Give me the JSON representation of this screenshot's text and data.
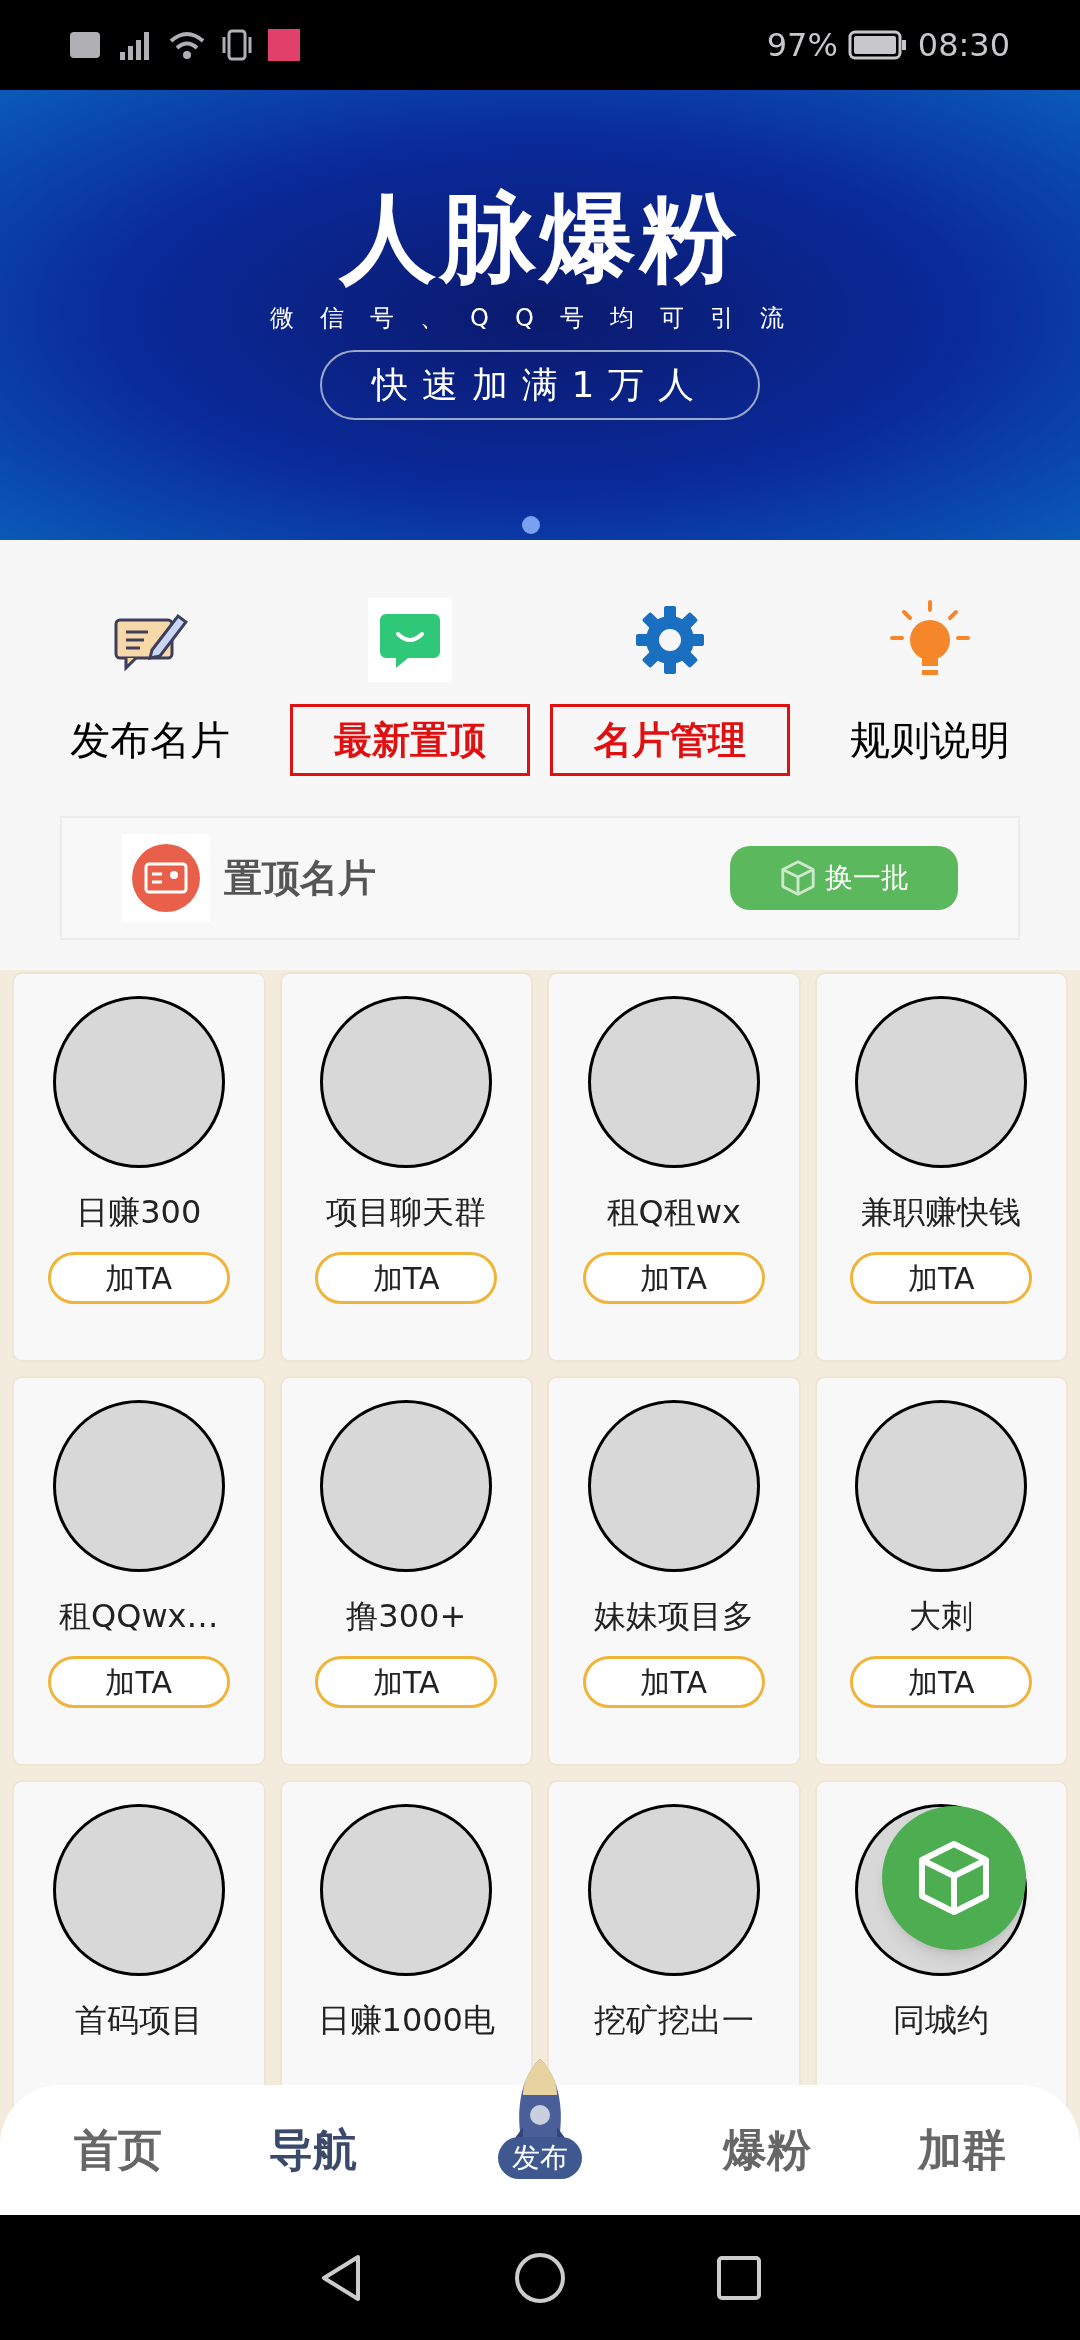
{
  "status_bar": {
    "battery": "97%",
    "time": "08:30"
  },
  "banner": {
    "title": "人脉爆粉",
    "subtitle": "微信号、QQ号均可引流",
    "pill": "快速加满1万人"
  },
  "quick_actions": [
    {
      "kind": "plain",
      "label": "发布名片"
    },
    {
      "kind": "boxed",
      "label": "最新置顶"
    },
    {
      "kind": "boxed",
      "label": "名片管理"
    },
    {
      "kind": "plain",
      "label": "规则说明"
    }
  ],
  "pinned": {
    "title": "置顶名片",
    "refresh_button": "换一批"
  },
  "cards": [
    {
      "name": "日赚300",
      "button": "加TA"
    },
    {
      "name": "项目聊天群",
      "button": "加TA"
    },
    {
      "name": "租Q租wx",
      "button": "加TA"
    },
    {
      "name": "兼职赚快钱",
      "button": "加TA"
    },
    {
      "name": "租QQwx…",
      "button": "加TA"
    },
    {
      "name": "撸300+",
      "button": "加TA"
    },
    {
      "name": "妹妹项目多",
      "button": "加TA"
    },
    {
      "name": "大刺",
      "button": "加TA"
    },
    {
      "name": "首码项目"
    },
    {
      "name": "日赚1000电"
    },
    {
      "name": "挖矿挖出一"
    },
    {
      "name": "同城约"
    }
  ],
  "bottom_nav": [
    {
      "kind": "tab",
      "label": "首页",
      "selected": false
    },
    {
      "kind": "tab",
      "label": "导航",
      "selected": true
    },
    {
      "kind": "center",
      "label": "发布",
      "selected": false
    },
    {
      "kind": "tab",
      "label": "爆粉",
      "selected": false
    },
    {
      "kind": "tab",
      "label": "加群",
      "selected": false
    }
  ]
}
